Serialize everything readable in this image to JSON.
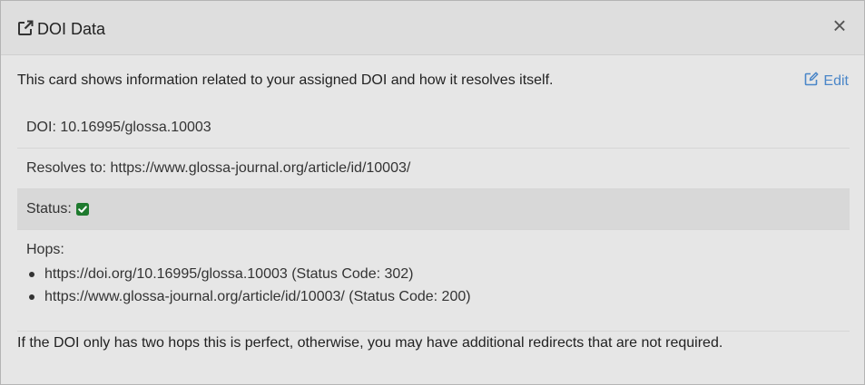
{
  "modal": {
    "title": "DOI Data",
    "header_icon": "external-link-icon",
    "close_label": "×"
  },
  "intro_text": "This card shows information related to your assigned DOI and how it resolves itself.",
  "edit": {
    "label": "Edit",
    "icon": "edit-icon",
    "color": "#4a86c8"
  },
  "rows": {
    "doi": "DOI: 10.16995/glossa.10003",
    "resolves": "Resolves to: https://www.glossa-journal.org/article/id/10003/",
    "status_label": "Status:",
    "status_icon": "check-square-icon",
    "status_color": "#1e7a2e",
    "hops_label": "Hops:"
  },
  "hops": [
    "https://doi.org/10.16995/glossa.10003 (Status Code: 302)",
    "https://www.glossa-journal.org/article/id/10003/ (Status Code: 200)"
  ],
  "footer_note": "If the DOI only has two hops this is perfect, otherwise, you may have additional redirects that are not required."
}
